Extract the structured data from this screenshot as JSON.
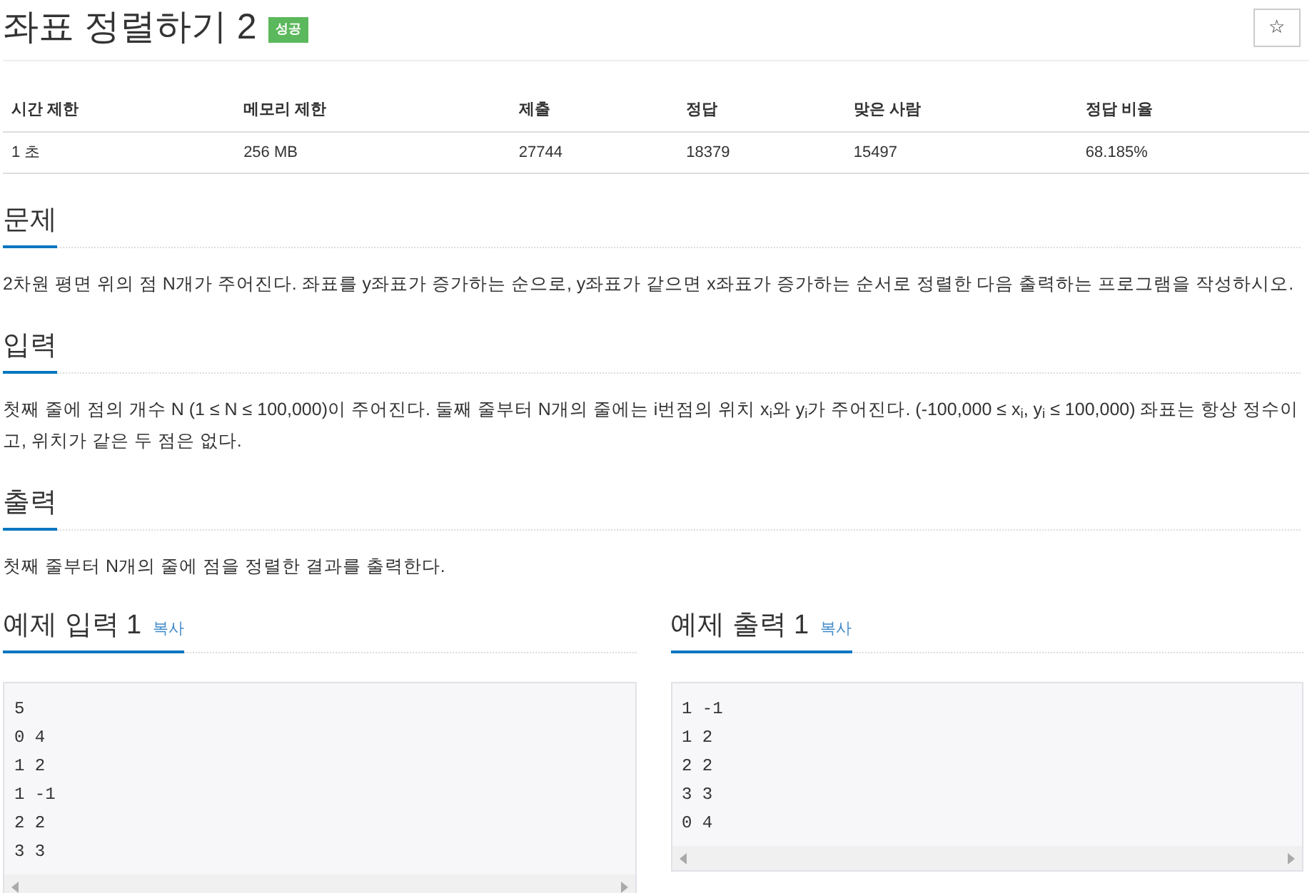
{
  "problem": {
    "title": "좌표 정렬하기 2",
    "badge": "성공",
    "star_button": "☆"
  },
  "info_table": {
    "columns": [
      "시간 제한",
      "메모리 제한",
      "제출",
      "정답",
      "맞은 사람",
      "정답 비율"
    ],
    "rows": [
      [
        "1 초",
        "256 MB",
        "27744",
        "18379",
        "15497",
        "68.185%"
      ]
    ]
  },
  "sections": [
    {
      "heading": "문제",
      "paragraphs": [
        "2차원 평면 위의 점 N개가 주어진다. 좌표를 y좌표가 증가하는 순으로, y좌표가 같으면 x좌표가 증가하는 순서로 정렬한 다음 출력하는 프로그램을 작성하시오."
      ]
    },
    {
      "heading": "입력",
      "paragraphs": [
        "첫째 줄에 점의 개수 N (1 ≤ N ≤ 100,000)이 주어진다. 둘째 줄부터 N개의 줄에는 i번점의 위치 x$_{i}$와 y$_{i}$가 주어진다. (-100,000 ≤ x$_{i}$, y$_{i}$ ≤ 100,000) 좌표는 항상 정수이고, 위치가 같은 두 점은 없다."
      ]
    },
    {
      "heading": "출력",
      "paragraphs": [
        "첫째 줄부터 N개의 줄에 점을 정렬한 결과를 출력한다."
      ]
    }
  ],
  "samples": [
    {
      "heading": "예제 입력 1",
      "copy": "복사",
      "lines": [
        "5",
        "0 4",
        "1 2",
        "1 -1",
        "2 2",
        "3 3"
      ]
    },
    {
      "heading": "예제 출력 1",
      "copy": "복사",
      "lines": [
        "1 -1",
        "1 2",
        "2 2",
        "3 3",
        "0 4"
      ]
    }
  ]
}
